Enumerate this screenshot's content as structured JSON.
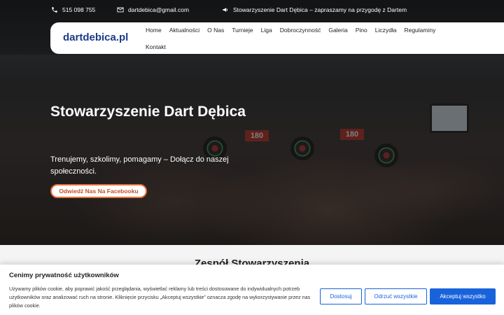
{
  "topbar": {
    "phone": "515 098 755",
    "email": "dartdebica@gmail.com",
    "announcement": "Stowarzyszenie Dart Dębica – zapraszamy na przygodę z Dartem"
  },
  "nav": {
    "logo": "dartdebica.pl",
    "items": [
      "Home",
      "Aktualności",
      "O Nas",
      "Turnieje",
      "Liga",
      "Dobroczynność",
      "Galeria",
      "Pino",
      "Liczydła",
      "Regulaminy",
      "Kontakt"
    ]
  },
  "hero": {
    "title": "Stowarzyszenie Dart Dębica",
    "subtitle": "Trenujemy, szkolimy, pomagamy – Dołącz do naszej społeczności.",
    "button": "Odwiedź Nas Na Facebooku",
    "sign": "180"
  },
  "section": {
    "heading": "Zespół Stowarzyszenia"
  },
  "cookie": {
    "title": "Cenimy prywatność użytkowników",
    "text": "Używamy plików cookie, aby poprawić jakość przeglądania, wyświetlać reklamy lub treści dostosowane do indywidualnych potrzeb użytkowników oraz analizować ruch na stronie. Kliknięcie przycisku „Akceptuj wszystkie” oznacza zgodę na wykorzystywanie przez nas plików cookie.",
    "btn_customize": "Dostosuj",
    "btn_reject": "Odrzuć wszystkie",
    "btn_accept": "Akceptuj wszystko"
  },
  "colors": {
    "accent": "#1863dc",
    "logo": "#1e3a8a",
    "hero_button_border": "#e8703a"
  }
}
